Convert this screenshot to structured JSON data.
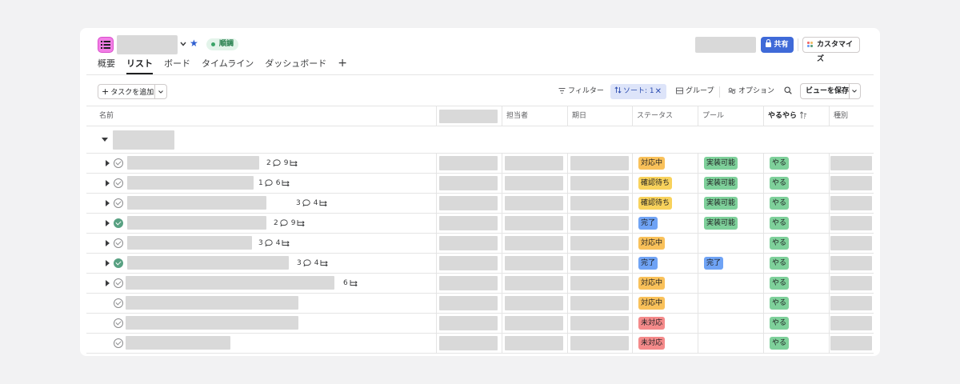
{
  "header": {
    "status": "順調",
    "share_label": "共有",
    "customize_label": "カスタマイズ"
  },
  "tabs": [
    "概要",
    "リスト",
    "ボード",
    "タイムライン",
    "ダッシュボード"
  ],
  "tab_add": "+",
  "toolbar": {
    "add_task": "タスクを追加",
    "filter": "フィルター",
    "sort": "ソート: 1",
    "group": "グループ",
    "options": "オプション",
    "save_view": "ビューを保存"
  },
  "table": {
    "columns": {
      "name": "名前",
      "assignee": "担当者",
      "due": "期日",
      "status": "ステータス",
      "pool": "プール",
      "yaru": "やるやら",
      "type": "種別"
    },
    "rows": [
      {
        "subtasks": true,
        "done": false,
        "comments": "2",
        "subcount": "9",
        "status": "対応中",
        "status_color": "orange",
        "pool": "実装可能",
        "yaru": "やる"
      },
      {
        "subtasks": true,
        "done": false,
        "comments": "1",
        "subcount": "6",
        "status": "確認待ち",
        "status_color": "yellow",
        "pool": "実装可能",
        "yaru": "やる"
      },
      {
        "subtasks": true,
        "done": false,
        "comments": "3",
        "subcount": "4",
        "status": "確認待ち",
        "status_color": "yellow",
        "pool": "実装可能",
        "yaru": "やる"
      },
      {
        "subtasks": true,
        "done": true,
        "comments": "2",
        "subcount": "9",
        "status": "完了",
        "status_color": "blue",
        "pool": "実装可能",
        "yaru": "やる"
      },
      {
        "subtasks": true,
        "done": false,
        "comments": "3",
        "subcount": "4",
        "status": "対応中",
        "status_color": "orange",
        "pool": "",
        "yaru": "やる"
      },
      {
        "subtasks": true,
        "done": true,
        "comments": "3",
        "subcount": "4",
        "status": "完了",
        "status_color": "blue",
        "pool": "完了",
        "yaru": "やる"
      },
      {
        "subtasks": true,
        "done": false,
        "comments": "",
        "subcount": "6",
        "status": "対応中",
        "status_color": "orange",
        "pool": "",
        "yaru": "やる"
      },
      {
        "subtasks": false,
        "done": false,
        "comments": "",
        "subcount": "",
        "status": "対応中",
        "status_color": "orange",
        "pool": "",
        "yaru": "やる"
      },
      {
        "subtasks": false,
        "done": false,
        "comments": "",
        "subcount": "",
        "status": "未対応",
        "status_color": "red",
        "pool": "",
        "yaru": "やる"
      },
      {
        "subtasks": false,
        "done": false,
        "comments": "",
        "subcount": "",
        "status": "未対応",
        "status_color": "red",
        "pool": "",
        "yaru": "やる"
      }
    ]
  },
  "colors": {
    "project_icon": "#f27ee6",
    "share_button": "#3f6ad8",
    "status_on_track": "#3aa468",
    "sort_chip": "#dde4f9",
    "tag_orange": "#f9c15a",
    "tag_yellow": "#f8d25c",
    "tag_blue": "#6fa3f5",
    "tag_green": "#7ed09a",
    "tag_red": "#f48a8a",
    "check_done": "#58a182"
  },
  "icons": [
    "list-icon",
    "chevron-down-icon",
    "star-icon",
    "lock-icon",
    "palette-icon",
    "plus-icon",
    "filter-icon",
    "sort-icon",
    "close-icon",
    "group-icon",
    "options-icon",
    "search-icon",
    "caret-down-icon",
    "caret-right-icon",
    "check-circle-icon",
    "comment-icon",
    "subtask-icon",
    "sort-ascending-icon"
  ]
}
